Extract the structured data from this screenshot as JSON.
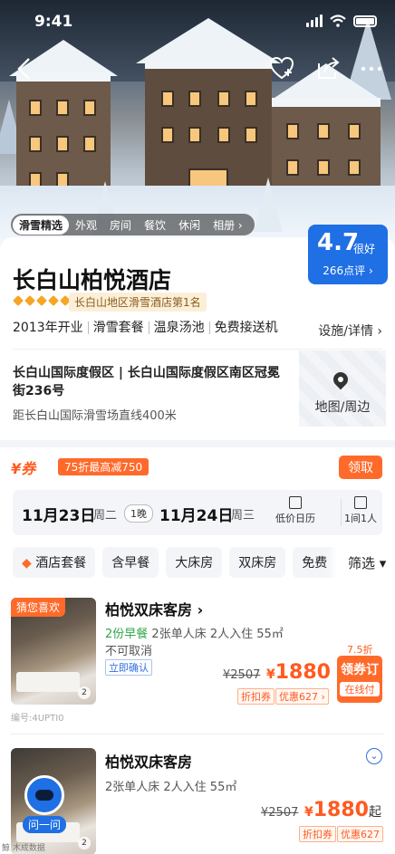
{
  "status": {
    "time": "9:41"
  },
  "hero_tabs": [
    "滑雪精选",
    "外观",
    "房间",
    "餐饮",
    "休闲",
    "相册 ›"
  ],
  "score": {
    "value": "4.7",
    "level": "很好",
    "reviews": "266点评 ›"
  },
  "hotel": {
    "name": "长白山柏悦酒店",
    "rank": "长白山地区滑雪酒店第1名",
    "features": [
      "2013年开业",
      "滑雪套餐",
      "温泉汤池",
      "免费接送机"
    ],
    "facility_link": "设施/详情 ›",
    "address": "长白山国际度假区 | 长白山国际度假区南区冠冕街236号",
    "distance": "距长白山国际滑雪场直线400米",
    "map_label": "地图/周边"
  },
  "coupon": {
    "logo": "¥券",
    "tag": "75折最高减750",
    "button": "领取"
  },
  "dates": {
    "checkin": "11月23日",
    "checkin_week": "周二",
    "nights": "1晚",
    "checkout": "11月24日",
    "checkout_week": "周三",
    "calendar": "低价日历",
    "guests": "1间1人"
  },
  "filters": [
    "酒店套餐",
    "含早餐",
    "大床房",
    "双床房",
    "免费"
  ],
  "filter_button": "筛选 ▾",
  "rooms": [
    {
      "tag": "猜您喜欢",
      "name": "柏悦双床客房 ›",
      "breakfast": "2份早餐",
      "spec": "2张单人床  2人入住  55㎡",
      "cancel": "不可取消",
      "confirm": "立即确认",
      "old_price": "¥2507",
      "price_currency": "¥",
      "price": "1880",
      "badge1": "折扣券",
      "badge2": "优惠627 ›",
      "discount": "7.5折",
      "book_main": "领券订",
      "book_sub": "在线付",
      "photos": "2",
      "code": "编号:4UPTI0"
    },
    {
      "name": "柏悦双床客房",
      "spec": "2张单人床  2人入住  55㎡",
      "old_price": "¥2507",
      "price_currency": "¥",
      "price": "1880",
      "price_suffix": "起",
      "badge1": "折扣券",
      "badge2": "优惠627",
      "photos": "2"
    }
  ],
  "ask": "问一问",
  "watermark": "鲸 木成数据"
}
